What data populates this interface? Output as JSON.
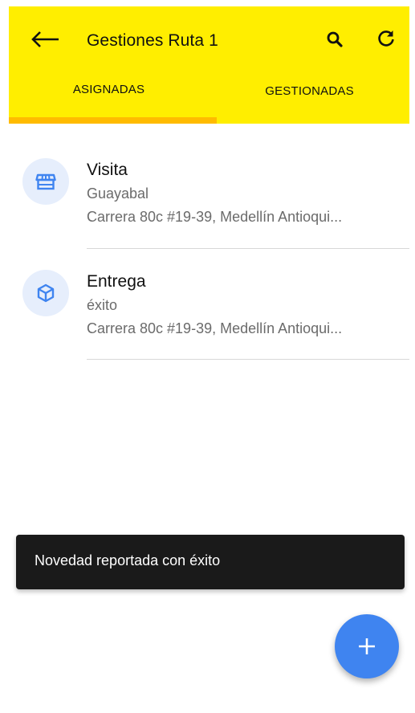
{
  "header": {
    "title": "Gestiones Ruta 1",
    "back_icon": "arrow-left-icon",
    "search_icon": "search-icon",
    "refresh_icon": "refresh-icon",
    "background_color": "#ffee00"
  },
  "tabs": [
    {
      "label": "ASIGNADAS",
      "selected": true
    },
    {
      "label": "GESTIONADAS",
      "selected": false
    }
  ],
  "tab_indicator_color": "#ffbb00",
  "items": [
    {
      "icon": "store-icon",
      "title": "Visita",
      "subtitle": "Guayabal",
      "address": "Carrera 80c #19-39, Medellín Antioqui..."
    },
    {
      "icon": "box-icon",
      "title": "Entrega",
      "subtitle": "éxito",
      "address": "Carrera 80c #19-39, Medellín Antioqui..."
    }
  ],
  "snackbar": {
    "message": "Novedad reportada con éxito"
  },
  "fab": {
    "icon": "plus-icon",
    "color": "#3f84f0"
  },
  "accent_color": "#3f84f0"
}
